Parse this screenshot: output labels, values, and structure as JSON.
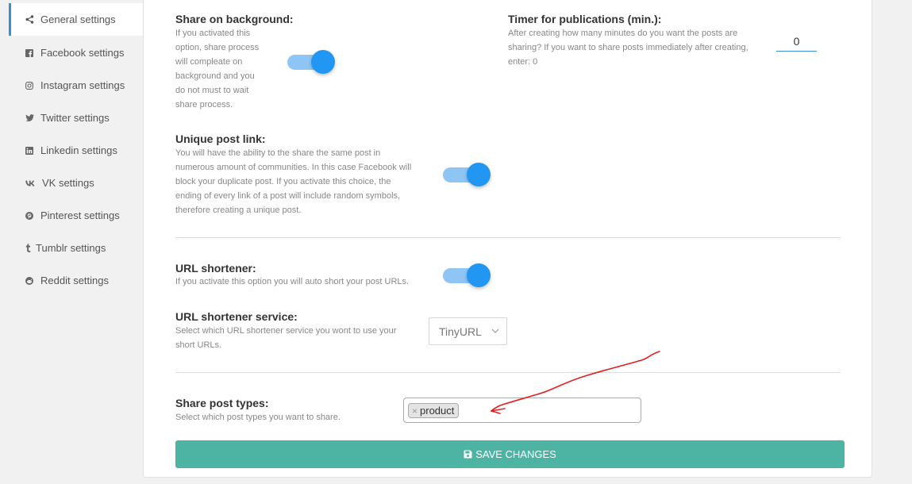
{
  "sidebar": {
    "items": [
      {
        "label": "General settings",
        "icon": "share-icon",
        "active": true
      },
      {
        "label": "Facebook settings",
        "icon": "facebook-icon"
      },
      {
        "label": "Instagram settings",
        "icon": "instagram-icon"
      },
      {
        "label": "Twitter settings",
        "icon": "twitter-icon"
      },
      {
        "label": "Linkedin settings",
        "icon": "linkedin-icon"
      },
      {
        "label": "VK settings",
        "icon": "vk-icon"
      },
      {
        "label": "Pinterest settings",
        "icon": "pinterest-icon"
      },
      {
        "label": "Tumblr settings",
        "icon": "tumblr-icon"
      },
      {
        "label": "Reddit settings",
        "icon": "reddit-icon"
      }
    ]
  },
  "share_background": {
    "label": "Share on background:",
    "desc_lines": [
      "If you activated this",
      "option, share process",
      "will compleate on",
      "background and you",
      "do not must to wait",
      "share process."
    ],
    "enabled": true
  },
  "timer": {
    "label": "Timer for publications (min.):",
    "desc_lines": [
      "After creating how many minutes do you want the posts are",
      "sharing? If you want to share posts immediately after creating,",
      "enter: 0"
    ],
    "value": "0"
  },
  "unique_link": {
    "label": "Unique post link:",
    "desc_lines": [
      "You will have the ability to the share the same post in",
      "numerous amount of communities. In this case Facebook will",
      "block your duplicate post. If you activate this choice, the",
      "ending of every link of a post will include random symbols,",
      "therefore creating a unique post."
    ],
    "enabled": true
  },
  "url_shortener": {
    "label": "URL shortener:",
    "desc": "If you activate this option you will auto short your post URLs.",
    "enabled": true
  },
  "shortener_service": {
    "label": "URL shortener service:",
    "desc_lines": [
      "Select which URL shortener service you wont to use your",
      "short URLs."
    ],
    "selected": "TinyURL"
  },
  "post_types": {
    "label": "Share post types:",
    "desc": "Select which post types you want to share.",
    "tags": [
      "product"
    ],
    "remove_glyph": "×"
  },
  "save": {
    "label": "SAVE CHANGES"
  },
  "colors": {
    "accent": "#2196f3",
    "track": "#8ec5f5",
    "save_button": "#4db3a2",
    "annotation": "#e02020"
  }
}
